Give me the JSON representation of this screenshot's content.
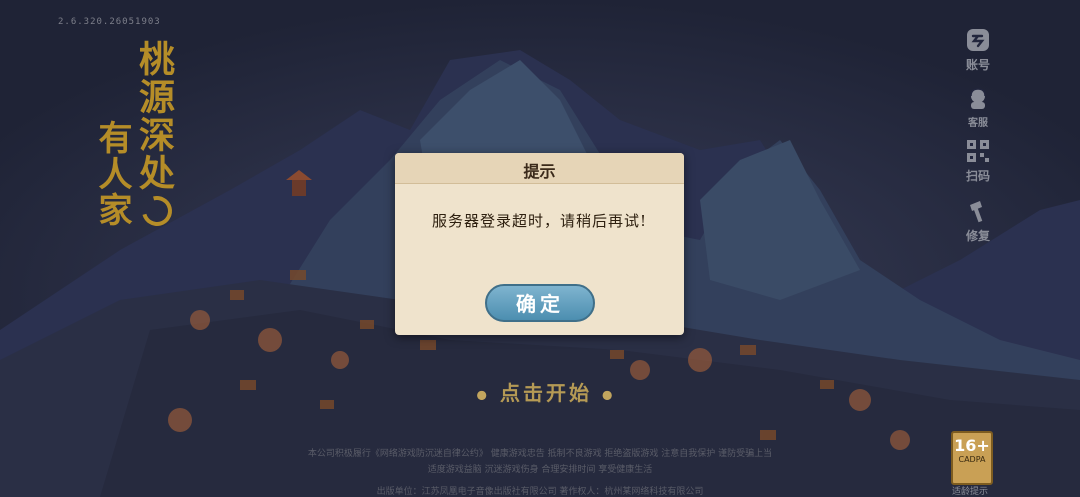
{
  "version": "2.6.320.26051903",
  "logo": {
    "line1": "桃源深处",
    "line2": "有人家"
  },
  "side_buttons": [
    {
      "label": "账号",
      "icon": "account-icon"
    },
    {
      "label": "客服",
      "icon": "customer-service-icon"
    },
    {
      "label": "扫码",
      "icon": "qr-code-icon"
    },
    {
      "label": "修复",
      "icon": "repair-hammer-icon"
    }
  ],
  "start_text": "点击开始",
  "footer": {
    "line1": "本公司积极履行《网络游戏防沉迷自律公约》  健康游戏忠告  抵制不良游戏  拒绝盗版游戏  注意自我保护  谨防受骗上当",
    "line2": "适度游戏益脑  沉迷游戏伤身  合理安排时间  享受健康生活",
    "line3": "出版单位：江苏凤凰电子音像出版社有限公司    著作权人：杭州某网络科技有限公司"
  },
  "age_rating": {
    "value": "16+",
    "caption": "CADPA",
    "label": "适龄提示"
  },
  "dialog": {
    "title": "提示",
    "message": "服务器登录超时，请稍后再试!",
    "confirm_label": "确定"
  },
  "colors": {
    "background": "#22263d",
    "dialog_bg": "#efe3cc",
    "button": "#5a9cbd",
    "logo_gold": "#b58d28"
  }
}
